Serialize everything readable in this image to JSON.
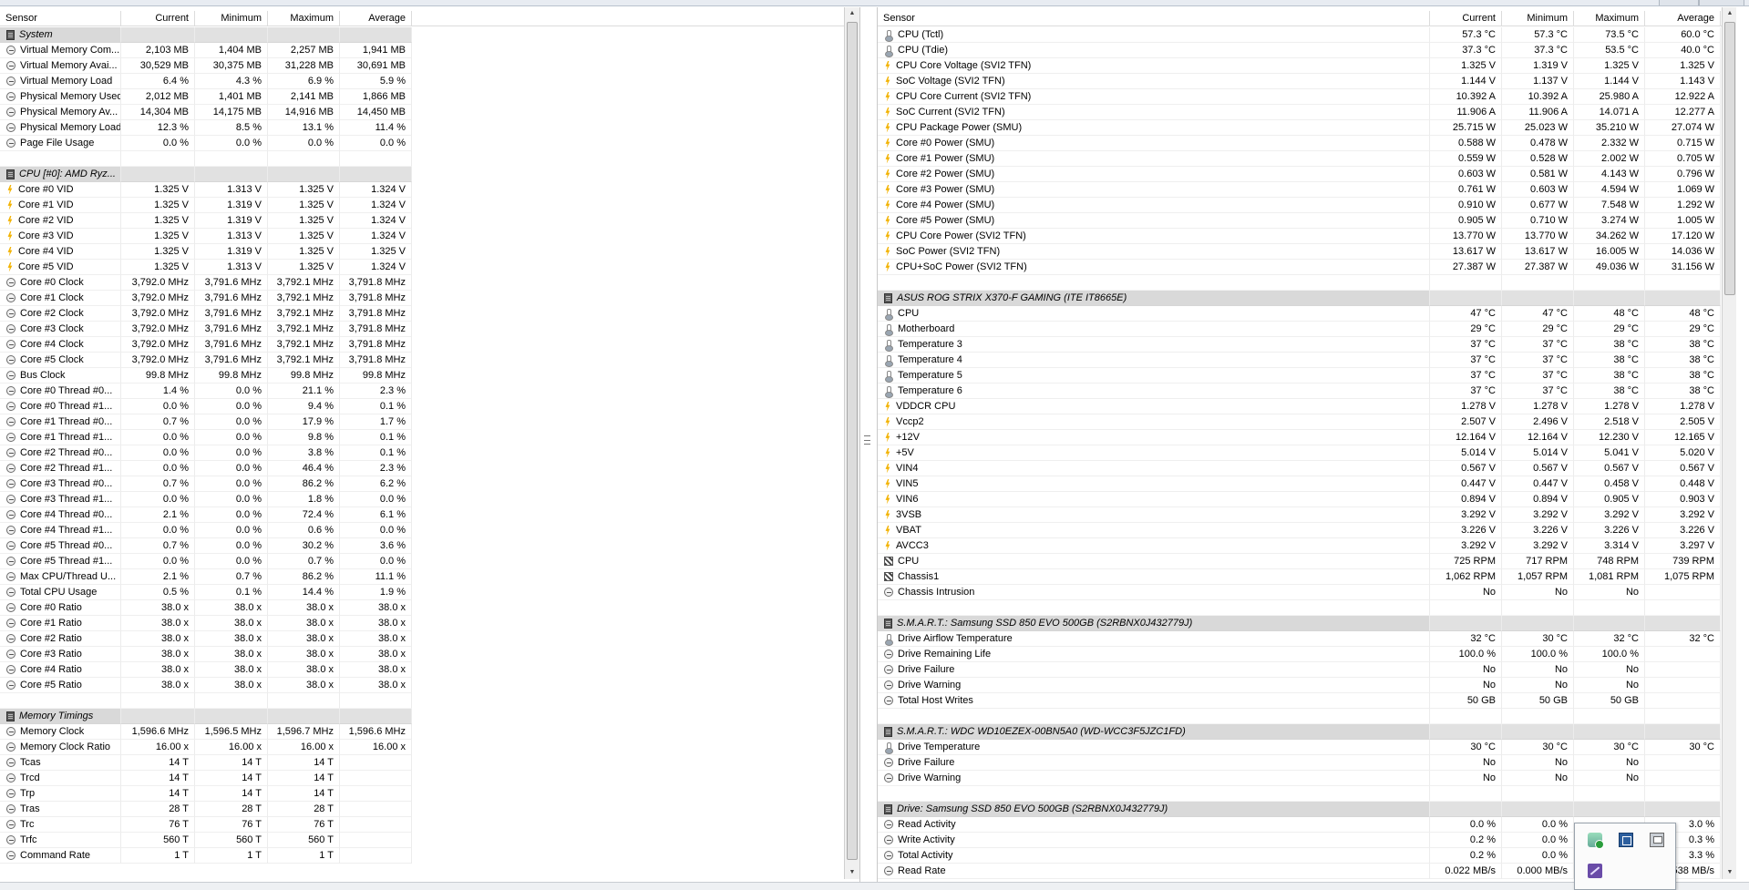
{
  "columns": [
    "Sensor",
    "Current",
    "Minimum",
    "Maximum",
    "Average"
  ],
  "left_rows": [
    {
      "t": "group",
      "icon": "chip-icon",
      "label": "System"
    },
    {
      "t": "row",
      "icon": "clock-icon",
      "label": "Virtual Memory Com...",
      "cur": "2,103 MB",
      "min": "1,404 MB",
      "max": "2,257 MB",
      "avg": "1,941 MB"
    },
    {
      "t": "row",
      "icon": "clock-icon",
      "label": "Virtual Memory Avai...",
      "cur": "30,529 MB",
      "min": "30,375 MB",
      "max": "31,228 MB",
      "avg": "30,691 MB"
    },
    {
      "t": "row",
      "icon": "clock-icon",
      "label": "Virtual Memory Load",
      "cur": "6.4 %",
      "min": "4.3 %",
      "max": "6.9 %",
      "avg": "5.9 %"
    },
    {
      "t": "row",
      "icon": "clock-icon",
      "label": "Physical Memory Used",
      "cur": "2,012 MB",
      "min": "1,401 MB",
      "max": "2,141 MB",
      "avg": "1,866 MB"
    },
    {
      "t": "row",
      "icon": "clock-icon",
      "label": "Physical Memory Av...",
      "cur": "14,304 MB",
      "min": "14,175 MB",
      "max": "14,916 MB",
      "avg": "14,450 MB"
    },
    {
      "t": "row",
      "icon": "clock-icon",
      "label": "Physical Memory Load",
      "cur": "12.3 %",
      "min": "8.5 %",
      "max": "13.1 %",
      "avg": "11.4 %"
    },
    {
      "t": "row",
      "icon": "clock-icon",
      "label": "Page File Usage",
      "cur": "0.0 %",
      "min": "0.0 %",
      "max": "0.0 %",
      "avg": "0.0 %"
    },
    {
      "t": "blank"
    },
    {
      "t": "group",
      "icon": "chip-icon",
      "label": "CPU [#0]: AMD Ryz..."
    },
    {
      "t": "row",
      "icon": "bolt-icon",
      "label": "Core #0 VID",
      "cur": "1.325 V",
      "min": "1.313 V",
      "max": "1.325 V",
      "avg": "1.324 V"
    },
    {
      "t": "row",
      "icon": "bolt-icon",
      "label": "Core #1 VID",
      "cur": "1.325 V",
      "min": "1.319 V",
      "max": "1.325 V",
      "avg": "1.324 V"
    },
    {
      "t": "row",
      "icon": "bolt-icon",
      "label": "Core #2 VID",
      "cur": "1.325 V",
      "min": "1.319 V",
      "max": "1.325 V",
      "avg": "1.324 V"
    },
    {
      "t": "row",
      "icon": "bolt-icon",
      "label": "Core #3 VID",
      "cur": "1.325 V",
      "min": "1.313 V",
      "max": "1.325 V",
      "avg": "1.324 V"
    },
    {
      "t": "row",
      "icon": "bolt-icon",
      "label": "Core #4 VID",
      "cur": "1.325 V",
      "min": "1.319 V",
      "max": "1.325 V",
      "avg": "1.325 V"
    },
    {
      "t": "row",
      "icon": "bolt-icon",
      "label": "Core #5 VID",
      "cur": "1.325 V",
      "min": "1.313 V",
      "max": "1.325 V",
      "avg": "1.324 V"
    },
    {
      "t": "row",
      "icon": "clock-icon",
      "label": "Core #0 Clock",
      "cur": "3,792.0 MHz",
      "min": "3,791.6 MHz",
      "max": "3,792.1 MHz",
      "avg": "3,791.8 MHz"
    },
    {
      "t": "row",
      "icon": "clock-icon",
      "label": "Core #1 Clock",
      "cur": "3,792.0 MHz",
      "min": "3,791.6 MHz",
      "max": "3,792.1 MHz",
      "avg": "3,791.8 MHz"
    },
    {
      "t": "row",
      "icon": "clock-icon",
      "label": "Core #2 Clock",
      "cur": "3,792.0 MHz",
      "min": "3,791.6 MHz",
      "max": "3,792.1 MHz",
      "avg": "3,791.8 MHz"
    },
    {
      "t": "row",
      "icon": "clock-icon",
      "label": "Core #3 Clock",
      "cur": "3,792.0 MHz",
      "min": "3,791.6 MHz",
      "max": "3,792.1 MHz",
      "avg": "3,791.8 MHz"
    },
    {
      "t": "row",
      "icon": "clock-icon",
      "label": "Core #4 Clock",
      "cur": "3,792.0 MHz",
      "min": "3,791.6 MHz",
      "max": "3,792.1 MHz",
      "avg": "3,791.8 MHz"
    },
    {
      "t": "row",
      "icon": "clock-icon",
      "label": "Core #5 Clock",
      "cur": "3,792.0 MHz",
      "min": "3,791.6 MHz",
      "max": "3,792.1 MHz",
      "avg": "3,791.8 MHz"
    },
    {
      "t": "row",
      "icon": "clock-icon",
      "label": "Bus Clock",
      "cur": "99.8 MHz",
      "min": "99.8 MHz",
      "max": "99.8 MHz",
      "avg": "99.8 MHz"
    },
    {
      "t": "row",
      "icon": "clock-icon",
      "label": "Core #0 Thread #0...",
      "cur": "1.4 %",
      "min": "0.0 %",
      "max": "21.1 %",
      "avg": "2.3 %"
    },
    {
      "t": "row",
      "icon": "clock-icon",
      "label": "Core #0 Thread #1...",
      "cur": "0.0 %",
      "min": "0.0 %",
      "max": "9.4 %",
      "avg": "0.1 %"
    },
    {
      "t": "row",
      "icon": "clock-icon",
      "label": "Core #1 Thread #0...",
      "cur": "0.7 %",
      "min": "0.0 %",
      "max": "17.9 %",
      "avg": "1.7 %"
    },
    {
      "t": "row",
      "icon": "clock-icon",
      "label": "Core #1 Thread #1...",
      "cur": "0.0 %",
      "min": "0.0 %",
      "max": "9.8 %",
      "avg": "0.1 %"
    },
    {
      "t": "row",
      "icon": "clock-icon",
      "label": "Core #2 Thread #0...",
      "cur": "0.0 %",
      "min": "0.0 %",
      "max": "3.8 %",
      "avg": "0.1 %"
    },
    {
      "t": "row",
      "icon": "clock-icon",
      "label": "Core #2 Thread #1...",
      "cur": "0.0 %",
      "min": "0.0 %",
      "max": "46.4 %",
      "avg": "2.3 %"
    },
    {
      "t": "row",
      "icon": "clock-icon",
      "label": "Core #3 Thread #0...",
      "cur": "0.7 %",
      "min": "0.0 %",
      "max": "86.2 %",
      "avg": "6.2 %"
    },
    {
      "t": "row",
      "icon": "clock-icon",
      "label": "Core #3 Thread #1...",
      "cur": "0.0 %",
      "min": "0.0 %",
      "max": "1.8 %",
      "avg": "0.0 %"
    },
    {
      "t": "row",
      "icon": "clock-icon",
      "label": "Core #4 Thread #0...",
      "cur": "2.1 %",
      "min": "0.0 %",
      "max": "72.4 %",
      "avg": "6.1 %"
    },
    {
      "t": "row",
      "icon": "clock-icon",
      "label": "Core #4 Thread #1...",
      "cur": "0.0 %",
      "min": "0.0 %",
      "max": "0.6 %",
      "avg": "0.0 %"
    },
    {
      "t": "row",
      "icon": "clock-icon",
      "label": "Core #5 Thread #0...",
      "cur": "0.7 %",
      "min": "0.0 %",
      "max": "30.2 %",
      "avg": "3.6 %"
    },
    {
      "t": "row",
      "icon": "clock-icon",
      "label": "Core #5 Thread #1...",
      "cur": "0.0 %",
      "min": "0.0 %",
      "max": "0.7 %",
      "avg": "0.0 %"
    },
    {
      "t": "row",
      "icon": "clock-icon",
      "label": "Max CPU/Thread U...",
      "cur": "2.1 %",
      "min": "0.7 %",
      "max": "86.2 %",
      "avg": "11.1 %"
    },
    {
      "t": "row",
      "icon": "clock-icon",
      "label": "Total CPU Usage",
      "cur": "0.5 %",
      "min": "0.1 %",
      "max": "14.4 %",
      "avg": "1.9 %"
    },
    {
      "t": "row",
      "icon": "clock-icon",
      "label": "Core #0 Ratio",
      "cur": "38.0 x",
      "min": "38.0 x",
      "max": "38.0 x",
      "avg": "38.0 x"
    },
    {
      "t": "row",
      "icon": "clock-icon",
      "label": "Core #1 Ratio",
      "cur": "38.0 x",
      "min": "38.0 x",
      "max": "38.0 x",
      "avg": "38.0 x"
    },
    {
      "t": "row",
      "icon": "clock-icon",
      "label": "Core #2 Ratio",
      "cur": "38.0 x",
      "min": "38.0 x",
      "max": "38.0 x",
      "avg": "38.0 x"
    },
    {
      "t": "row",
      "icon": "clock-icon",
      "label": "Core #3 Ratio",
      "cur": "38.0 x",
      "min": "38.0 x",
      "max": "38.0 x",
      "avg": "38.0 x"
    },
    {
      "t": "row",
      "icon": "clock-icon",
      "label": "Core #4 Ratio",
      "cur": "38.0 x",
      "min": "38.0 x",
      "max": "38.0 x",
      "avg": "38.0 x"
    },
    {
      "t": "row",
      "icon": "clock-icon",
      "label": "Core #5 Ratio",
      "cur": "38.0 x",
      "min": "38.0 x",
      "max": "38.0 x",
      "avg": "38.0 x"
    },
    {
      "t": "blank"
    },
    {
      "t": "group",
      "icon": "chip-icon",
      "label": "Memory Timings"
    },
    {
      "t": "row",
      "icon": "clock-icon",
      "label": "Memory Clock",
      "cur": "1,596.6 MHz",
      "min": "1,596.5 MHz",
      "max": "1,596.7 MHz",
      "avg": "1,596.6 MHz"
    },
    {
      "t": "row",
      "icon": "clock-icon",
      "label": "Memory Clock Ratio",
      "cur": "16.00 x",
      "min": "16.00 x",
      "max": "16.00 x",
      "avg": "16.00 x"
    },
    {
      "t": "row",
      "icon": "clock-icon",
      "label": "Tcas",
      "cur": "14 T",
      "min": "14 T",
      "max": "14 T",
      "avg": ""
    },
    {
      "t": "row",
      "icon": "clock-icon",
      "label": "Trcd",
      "cur": "14 T",
      "min": "14 T",
      "max": "14 T",
      "avg": ""
    },
    {
      "t": "row",
      "icon": "clock-icon",
      "label": "Trp",
      "cur": "14 T",
      "min": "14 T",
      "max": "14 T",
      "avg": ""
    },
    {
      "t": "row",
      "icon": "clock-icon",
      "label": "Tras",
      "cur": "28 T",
      "min": "28 T",
      "max": "28 T",
      "avg": ""
    },
    {
      "t": "row",
      "icon": "clock-icon",
      "label": "Trc",
      "cur": "76 T",
      "min": "76 T",
      "max": "76 T",
      "avg": ""
    },
    {
      "t": "row",
      "icon": "clock-icon",
      "label": "Trfc",
      "cur": "560 T",
      "min": "560 T",
      "max": "560 T",
      "avg": ""
    },
    {
      "t": "row",
      "icon": "clock-icon",
      "label": "Command Rate",
      "cur": "1 T",
      "min": "1 T",
      "max": "1 T",
      "avg": ""
    }
  ],
  "right_rows": [
    {
      "t": "row",
      "icon": "thermometer-icon",
      "label": "CPU (Tctl)",
      "cur": "57.3 °C",
      "min": "57.3 °C",
      "max": "73.5 °C",
      "avg": "60.0 °C"
    },
    {
      "t": "row",
      "icon": "thermometer-icon",
      "label": "CPU (Tdie)",
      "cur": "37.3 °C",
      "min": "37.3 °C",
      "max": "53.5 °C",
      "avg": "40.0 °C"
    },
    {
      "t": "row",
      "icon": "bolt-icon",
      "label": "CPU Core Voltage (SVI2 TFN)",
      "cur": "1.325 V",
      "min": "1.319 V",
      "max": "1.325 V",
      "avg": "1.325 V"
    },
    {
      "t": "row",
      "icon": "bolt-icon",
      "label": "SoC Voltage (SVI2 TFN)",
      "cur": "1.144 V",
      "min": "1.137 V",
      "max": "1.144 V",
      "avg": "1.143 V"
    },
    {
      "t": "row",
      "icon": "bolt-icon",
      "label": "CPU Core Current (SVI2 TFN)",
      "cur": "10.392 A",
      "min": "10.392 A",
      "max": "25.980 A",
      "avg": "12.922 A"
    },
    {
      "t": "row",
      "icon": "bolt-icon",
      "label": "SoC Current (SVI2 TFN)",
      "cur": "11.906 A",
      "min": "11.906 A",
      "max": "14.071 A",
      "avg": "12.277 A"
    },
    {
      "t": "row",
      "icon": "bolt-icon",
      "label": "CPU Package Power (SMU)",
      "cur": "25.715 W",
      "min": "25.023 W",
      "max": "35.210 W",
      "avg": "27.074 W"
    },
    {
      "t": "row",
      "icon": "bolt-icon",
      "label": "Core #0 Power (SMU)",
      "cur": "0.588 W",
      "min": "0.478 W",
      "max": "2.332 W",
      "avg": "0.715 W"
    },
    {
      "t": "row",
      "icon": "bolt-icon",
      "label": "Core #1 Power (SMU)",
      "cur": "0.559 W",
      "min": "0.528 W",
      "max": "2.002 W",
      "avg": "0.705 W"
    },
    {
      "t": "row",
      "icon": "bolt-icon",
      "label": "Core #2 Power (SMU)",
      "cur": "0.603 W",
      "min": "0.581 W",
      "max": "4.143 W",
      "avg": "0.796 W"
    },
    {
      "t": "row",
      "icon": "bolt-icon",
      "label": "Core #3 Power (SMU)",
      "cur": "0.761 W",
      "min": "0.603 W",
      "max": "4.594 W",
      "avg": "1.069 W"
    },
    {
      "t": "row",
      "icon": "bolt-icon",
      "label": "Core #4 Power (SMU)",
      "cur": "0.910 W",
      "min": "0.677 W",
      "max": "7.548 W",
      "avg": "1.292 W"
    },
    {
      "t": "row",
      "icon": "bolt-icon",
      "label": "Core #5 Power (SMU)",
      "cur": "0.905 W",
      "min": "0.710 W",
      "max": "3.274 W",
      "avg": "1.005 W"
    },
    {
      "t": "row",
      "icon": "bolt-icon",
      "label": "CPU Core Power (SVI2 TFN)",
      "cur": "13.770 W",
      "min": "13.770 W",
      "max": "34.262 W",
      "avg": "17.120 W"
    },
    {
      "t": "row",
      "icon": "bolt-icon",
      "label": "SoC Power (SVI2 TFN)",
      "cur": "13.617 W",
      "min": "13.617 W",
      "max": "16.005 W",
      "avg": "14.036 W"
    },
    {
      "t": "row",
      "icon": "bolt-icon",
      "label": "CPU+SoC Power (SVI2 TFN)",
      "cur": "27.387 W",
      "min": "27.387 W",
      "max": "49.036 W",
      "avg": "31.156 W"
    },
    {
      "t": "blank"
    },
    {
      "t": "group",
      "icon": "chip-icon",
      "label": "ASUS ROG STRIX X370-F GAMING (ITE IT8665E)"
    },
    {
      "t": "row",
      "icon": "thermometer-icon",
      "label": "CPU",
      "cur": "47 °C",
      "min": "47 °C",
      "max": "48 °C",
      "avg": "48 °C"
    },
    {
      "t": "row",
      "icon": "thermometer-icon",
      "label": "Motherboard",
      "cur": "29 °C",
      "min": "29 °C",
      "max": "29 °C",
      "avg": "29 °C"
    },
    {
      "t": "row",
      "icon": "thermometer-icon",
      "label": "Temperature 3",
      "cur": "37 °C",
      "min": "37 °C",
      "max": "38 °C",
      "avg": "38 °C"
    },
    {
      "t": "row",
      "icon": "thermometer-icon",
      "label": "Temperature 4",
      "cur": "37 °C",
      "min": "37 °C",
      "max": "38 °C",
      "avg": "38 °C"
    },
    {
      "t": "row",
      "icon": "thermometer-icon",
      "label": "Temperature 5",
      "cur": "37 °C",
      "min": "37 °C",
      "max": "38 °C",
      "avg": "38 °C"
    },
    {
      "t": "row",
      "icon": "thermometer-icon",
      "label": "Temperature 6",
      "cur": "37 °C",
      "min": "37 °C",
      "max": "38 °C",
      "avg": "38 °C"
    },
    {
      "t": "row",
      "icon": "bolt-icon",
      "label": "VDDCR CPU",
      "cur": "1.278 V",
      "min": "1.278 V",
      "max": "1.278 V",
      "avg": "1.278 V"
    },
    {
      "t": "row",
      "icon": "bolt-icon",
      "label": "Vccp2",
      "cur": "2.507 V",
      "min": "2.496 V",
      "max": "2.518 V",
      "avg": "2.505 V"
    },
    {
      "t": "row",
      "icon": "bolt-icon",
      "label": "+12V",
      "cur": "12.164 V",
      "min": "12.164 V",
      "max": "12.230 V",
      "avg": "12.165 V"
    },
    {
      "t": "row",
      "icon": "bolt-icon",
      "label": "+5V",
      "cur": "5.014 V",
      "min": "5.014 V",
      "max": "5.041 V",
      "avg": "5.020 V"
    },
    {
      "t": "row",
      "icon": "bolt-icon",
      "label": "VIN4",
      "cur": "0.567 V",
      "min": "0.567 V",
      "max": "0.567 V",
      "avg": "0.567 V"
    },
    {
      "t": "row",
      "icon": "bolt-icon",
      "label": "VIN5",
      "cur": "0.447 V",
      "min": "0.447 V",
      "max": "0.458 V",
      "avg": "0.448 V"
    },
    {
      "t": "row",
      "icon": "bolt-icon",
      "label": "VIN6",
      "cur": "0.894 V",
      "min": "0.894 V",
      "max": "0.905 V",
      "avg": "0.903 V"
    },
    {
      "t": "row",
      "icon": "bolt-icon",
      "label": "3VSB",
      "cur": "3.292 V",
      "min": "3.292 V",
      "max": "3.292 V",
      "avg": "3.292 V"
    },
    {
      "t": "row",
      "icon": "bolt-icon",
      "label": "VBAT",
      "cur": "3.226 V",
      "min": "3.226 V",
      "max": "3.226 V",
      "avg": "3.226 V"
    },
    {
      "t": "row",
      "icon": "bolt-icon",
      "label": "AVCC3",
      "cur": "3.292 V",
      "min": "3.292 V",
      "max": "3.314 V",
      "avg": "3.297 V"
    },
    {
      "t": "row",
      "icon": "fan-icon",
      "label": "CPU",
      "cur": "725 RPM",
      "min": "717 RPM",
      "max": "748 RPM",
      "avg": "739 RPM"
    },
    {
      "t": "row",
      "icon": "fan-icon",
      "label": "Chassis1",
      "cur": "1,062 RPM",
      "min": "1,057 RPM",
      "max": "1,081 RPM",
      "avg": "1,075 RPM"
    },
    {
      "t": "row",
      "icon": "clock-icon",
      "label": "Chassis Intrusion",
      "cur": "No",
      "min": "No",
      "max": "No",
      "avg": ""
    },
    {
      "t": "blank"
    },
    {
      "t": "group",
      "icon": "chip-icon",
      "label": "S.M.A.R.T.: Samsung SSD 850 EVO 500GB (S2RBNX0J432779J)"
    },
    {
      "t": "row",
      "icon": "thermometer-icon",
      "label": "Drive Airflow Temperature",
      "cur": "32 °C",
      "min": "30 °C",
      "max": "32 °C",
      "avg": "32 °C"
    },
    {
      "t": "row",
      "icon": "clock-icon",
      "label": "Drive Remaining Life",
      "cur": "100.0 %",
      "min": "100.0 %",
      "max": "100.0 %",
      "avg": ""
    },
    {
      "t": "row",
      "icon": "clock-icon",
      "label": "Drive Failure",
      "cur": "No",
      "min": "No",
      "max": "No",
      "avg": ""
    },
    {
      "t": "row",
      "icon": "clock-icon",
      "label": "Drive Warning",
      "cur": "No",
      "min": "No",
      "max": "No",
      "avg": ""
    },
    {
      "t": "row",
      "icon": "clock-icon",
      "label": "Total Host Writes",
      "cur": "50 GB",
      "min": "50 GB",
      "max": "50 GB",
      "avg": ""
    },
    {
      "t": "blank"
    },
    {
      "t": "group",
      "icon": "chip-icon",
      "label": "S.M.A.R.T.: WDC WD10EZEX-00BN5A0 (WD-WCC3F5JZC1FD)"
    },
    {
      "t": "row",
      "icon": "thermometer-icon",
      "label": "Drive Temperature",
      "cur": "30 °C",
      "min": "30 °C",
      "max": "30 °C",
      "avg": "30 °C"
    },
    {
      "t": "row",
      "icon": "clock-icon",
      "label": "Drive Failure",
      "cur": "No",
      "min": "No",
      "max": "No",
      "avg": ""
    },
    {
      "t": "row",
      "icon": "clock-icon",
      "label": "Drive Warning",
      "cur": "No",
      "min": "No",
      "max": "No",
      "avg": ""
    },
    {
      "t": "blank"
    },
    {
      "t": "group",
      "icon": "chip-icon",
      "label": "Drive: Samsung SSD 850 EVO 500GB (S2RBNX0J432779J)"
    },
    {
      "t": "row",
      "icon": "clock-icon",
      "label": "Read Activity",
      "cur": "0.0 %",
      "min": "0.0 %",
      "max": "",
      "avg": "3.0 %"
    },
    {
      "t": "row",
      "icon": "clock-icon",
      "label": "Write Activity",
      "cur": "0.2 %",
      "min": "0.0 %",
      "max": "",
      "avg": "0.3 %"
    },
    {
      "t": "row",
      "icon": "clock-icon",
      "label": "Total Activity",
      "cur": "0.2 %",
      "min": "0.0 %",
      "max": "",
      "avg": "3.3 %"
    },
    {
      "t": "row",
      "icon": "clock-icon",
      "label": "Read Rate",
      "cur": "0.022 MB/s",
      "min": "0.000 MB/s",
      "max": "",
      "avg": "538 MB/s"
    }
  ],
  "tray_icons": [
    "hdd-status-icon",
    "save-log-icon",
    "settings-icon",
    "graph-icon"
  ]
}
